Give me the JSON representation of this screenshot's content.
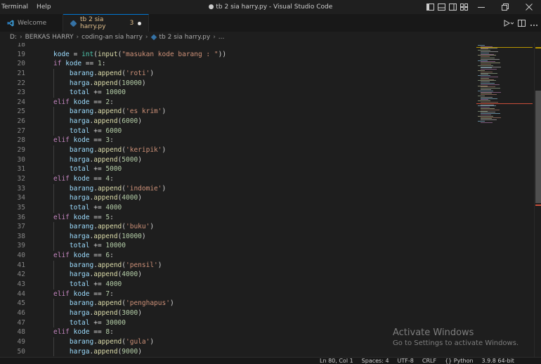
{
  "titlebar": {
    "menu": [
      "Terminal",
      "Help"
    ],
    "window_title": "● tb 2 sia harry.py - Visual Studio Code"
  },
  "tabs": [
    {
      "label": "Welcome",
      "icon": "vscode-icon",
      "active": false
    },
    {
      "label": "tb 2 sia harry.py",
      "problems": "3",
      "icon": "python-icon",
      "active": true,
      "dirty": true
    }
  ],
  "breadcrumb": [
    "D:",
    "BERKAS HARRY",
    "coding-an sia harry",
    "tb 2 sia harry.py",
    "..."
  ],
  "code": {
    "first_line": 18,
    "lines": [
      [],
      [
        [
          "var",
          "kode"
        ],
        [
          "op",
          " = "
        ],
        [
          "builtin",
          "int"
        ],
        [
          "op",
          "("
        ],
        [
          "fn",
          "input"
        ],
        [
          "op",
          "("
        ],
        [
          "str",
          "\"masukan kode barang : \""
        ],
        [
          "op",
          "))"
        ]
      ],
      [
        [
          "kw",
          "if"
        ],
        [
          "op",
          " "
        ],
        [
          "var",
          "kode"
        ],
        [
          "op",
          " == "
        ],
        [
          "num",
          "1"
        ],
        [
          "op",
          ":"
        ]
      ],
      [
        [
          "op",
          "    "
        ],
        [
          "var",
          "barang"
        ],
        [
          "op",
          "."
        ],
        [
          "fn",
          "append"
        ],
        [
          "op",
          "("
        ],
        [
          "str",
          "'roti'"
        ],
        [
          "op",
          ")"
        ]
      ],
      [
        [
          "op",
          "    "
        ],
        [
          "var",
          "harga"
        ],
        [
          "op",
          "."
        ],
        [
          "fn",
          "append"
        ],
        [
          "op",
          "("
        ],
        [
          "num",
          "10000"
        ],
        [
          "op",
          ")"
        ]
      ],
      [
        [
          "op",
          "    "
        ],
        [
          "var",
          "total"
        ],
        [
          "op",
          " += "
        ],
        [
          "num",
          "10000"
        ]
      ],
      [
        [
          "kw",
          "elif"
        ],
        [
          "op",
          " "
        ],
        [
          "var",
          "kode"
        ],
        [
          "op",
          " == "
        ],
        [
          "num",
          "2"
        ],
        [
          "op",
          ":"
        ]
      ],
      [
        [
          "op",
          "    "
        ],
        [
          "var",
          "barang"
        ],
        [
          "op",
          "."
        ],
        [
          "fn",
          "append"
        ],
        [
          "op",
          "("
        ],
        [
          "str",
          "'es krim'"
        ],
        [
          "op",
          ")"
        ]
      ],
      [
        [
          "op",
          "    "
        ],
        [
          "var",
          "harga"
        ],
        [
          "op",
          "."
        ],
        [
          "fn",
          "append"
        ],
        [
          "op",
          "("
        ],
        [
          "num",
          "6000"
        ],
        [
          "op",
          ")"
        ]
      ],
      [
        [
          "op",
          "    "
        ],
        [
          "var",
          "total"
        ],
        [
          "op",
          " += "
        ],
        [
          "num",
          "6000"
        ]
      ],
      [
        [
          "kw",
          "elif"
        ],
        [
          "op",
          " "
        ],
        [
          "var",
          "kode"
        ],
        [
          "op",
          " == "
        ],
        [
          "num",
          "3"
        ],
        [
          "op",
          ":"
        ]
      ],
      [
        [
          "op",
          "    "
        ],
        [
          "var",
          "barang"
        ],
        [
          "op",
          "."
        ],
        [
          "fn",
          "append"
        ],
        [
          "op",
          "("
        ],
        [
          "str",
          "'keripik'"
        ],
        [
          "op",
          ")"
        ]
      ],
      [
        [
          "op",
          "    "
        ],
        [
          "var",
          "harga"
        ],
        [
          "op",
          "."
        ],
        [
          "fn",
          "append"
        ],
        [
          "op",
          "("
        ],
        [
          "num",
          "5000"
        ],
        [
          "op",
          ")"
        ]
      ],
      [
        [
          "op",
          "    "
        ],
        [
          "var",
          "total"
        ],
        [
          "op",
          " += "
        ],
        [
          "num",
          "5000"
        ]
      ],
      [
        [
          "kw",
          "elif"
        ],
        [
          "op",
          " "
        ],
        [
          "var",
          "kode"
        ],
        [
          "op",
          " == "
        ],
        [
          "num",
          "4"
        ],
        [
          "op",
          ":"
        ]
      ],
      [
        [
          "op",
          "    "
        ],
        [
          "var",
          "barang"
        ],
        [
          "op",
          "."
        ],
        [
          "fn",
          "append"
        ],
        [
          "op",
          "("
        ],
        [
          "str",
          "'indomie'"
        ],
        [
          "op",
          ")"
        ]
      ],
      [
        [
          "op",
          "    "
        ],
        [
          "var",
          "harga"
        ],
        [
          "op",
          "."
        ],
        [
          "fn",
          "append"
        ],
        [
          "op",
          "("
        ],
        [
          "num",
          "4000"
        ],
        [
          "op",
          ")"
        ]
      ],
      [
        [
          "op",
          "    "
        ],
        [
          "var",
          "total"
        ],
        [
          "op",
          " += "
        ],
        [
          "num",
          "4000"
        ]
      ],
      [
        [
          "kw",
          "elif"
        ],
        [
          "op",
          " "
        ],
        [
          "var",
          "kode"
        ],
        [
          "op",
          " == "
        ],
        [
          "num",
          "5"
        ],
        [
          "op",
          ":"
        ]
      ],
      [
        [
          "op",
          "    "
        ],
        [
          "var",
          "barang"
        ],
        [
          "op",
          "."
        ],
        [
          "fn",
          "append"
        ],
        [
          "op",
          "("
        ],
        [
          "str",
          "'buku'"
        ],
        [
          "op",
          ")"
        ]
      ],
      [
        [
          "op",
          "    "
        ],
        [
          "var",
          "harga"
        ],
        [
          "op",
          "."
        ],
        [
          "fn",
          "append"
        ],
        [
          "op",
          "("
        ],
        [
          "num",
          "10000"
        ],
        [
          "op",
          ")"
        ]
      ],
      [
        [
          "op",
          "    "
        ],
        [
          "var",
          "total"
        ],
        [
          "op",
          " += "
        ],
        [
          "num",
          "10000"
        ]
      ],
      [
        [
          "kw",
          "elif"
        ],
        [
          "op",
          " "
        ],
        [
          "var",
          "kode"
        ],
        [
          "op",
          " == "
        ],
        [
          "num",
          "6"
        ],
        [
          "op",
          ":"
        ]
      ],
      [
        [
          "op",
          "    "
        ],
        [
          "var",
          "barang"
        ],
        [
          "op",
          "."
        ],
        [
          "fn",
          "append"
        ],
        [
          "op",
          "("
        ],
        [
          "str",
          "'pensil'"
        ],
        [
          "op",
          ")"
        ]
      ],
      [
        [
          "op",
          "    "
        ],
        [
          "var",
          "harga"
        ],
        [
          "op",
          "."
        ],
        [
          "fn",
          "append"
        ],
        [
          "op",
          "("
        ],
        [
          "num",
          "4000"
        ],
        [
          "op",
          ")"
        ]
      ],
      [
        [
          "op",
          "    "
        ],
        [
          "var",
          "total"
        ],
        [
          "op",
          " += "
        ],
        [
          "num",
          "4000"
        ]
      ],
      [
        [
          "kw",
          "elif"
        ],
        [
          "op",
          " "
        ],
        [
          "var",
          "kode"
        ],
        [
          "op",
          " == "
        ],
        [
          "num",
          "7"
        ],
        [
          "op",
          ":"
        ]
      ],
      [
        [
          "op",
          "    "
        ],
        [
          "var",
          "barang"
        ],
        [
          "op",
          "."
        ],
        [
          "fn",
          "append"
        ],
        [
          "op",
          "("
        ],
        [
          "str",
          "'penghapus'"
        ],
        [
          "op",
          ")"
        ]
      ],
      [
        [
          "op",
          "    "
        ],
        [
          "var",
          "harga"
        ],
        [
          "op",
          "."
        ],
        [
          "fn",
          "append"
        ],
        [
          "op",
          "("
        ],
        [
          "num",
          "3000"
        ],
        [
          "op",
          ")"
        ]
      ],
      [
        [
          "op",
          "    "
        ],
        [
          "var",
          "total"
        ],
        [
          "op",
          " += "
        ],
        [
          "num",
          "30000"
        ]
      ],
      [
        [
          "kw",
          "elif"
        ],
        [
          "op",
          " "
        ],
        [
          "var",
          "kode"
        ],
        [
          "op",
          " == "
        ],
        [
          "num",
          "8"
        ],
        [
          "op",
          ":"
        ]
      ],
      [
        [
          "op",
          "    "
        ],
        [
          "var",
          "barang"
        ],
        [
          "op",
          "."
        ],
        [
          "fn",
          "append"
        ],
        [
          "op",
          "("
        ],
        [
          "str",
          "'gula'"
        ],
        [
          "op",
          ")"
        ]
      ],
      [
        [
          "op",
          "    "
        ],
        [
          "var",
          "harga"
        ],
        [
          "op",
          "."
        ],
        [
          "fn",
          "append"
        ],
        [
          "op",
          "("
        ],
        [
          "num",
          "9000"
        ],
        [
          "op",
          ")"
        ]
      ]
    ]
  },
  "watermark": {
    "title": "Activate Windows",
    "subtitle": "Go to Settings to activate Windows."
  },
  "statusbar": {
    "items": [
      "Ln 80, Col 1",
      "Spaces: 4",
      "UTF-8",
      "CRLF",
      "{} Python",
      "3.9.8 64-bit"
    ]
  },
  "colors": {
    "accent": "#0078d4",
    "keyword": "#c586c0",
    "function": "#dcdcaa",
    "variable": "#9cdcfe",
    "number": "#b5cea8",
    "string": "#ce9178"
  }
}
